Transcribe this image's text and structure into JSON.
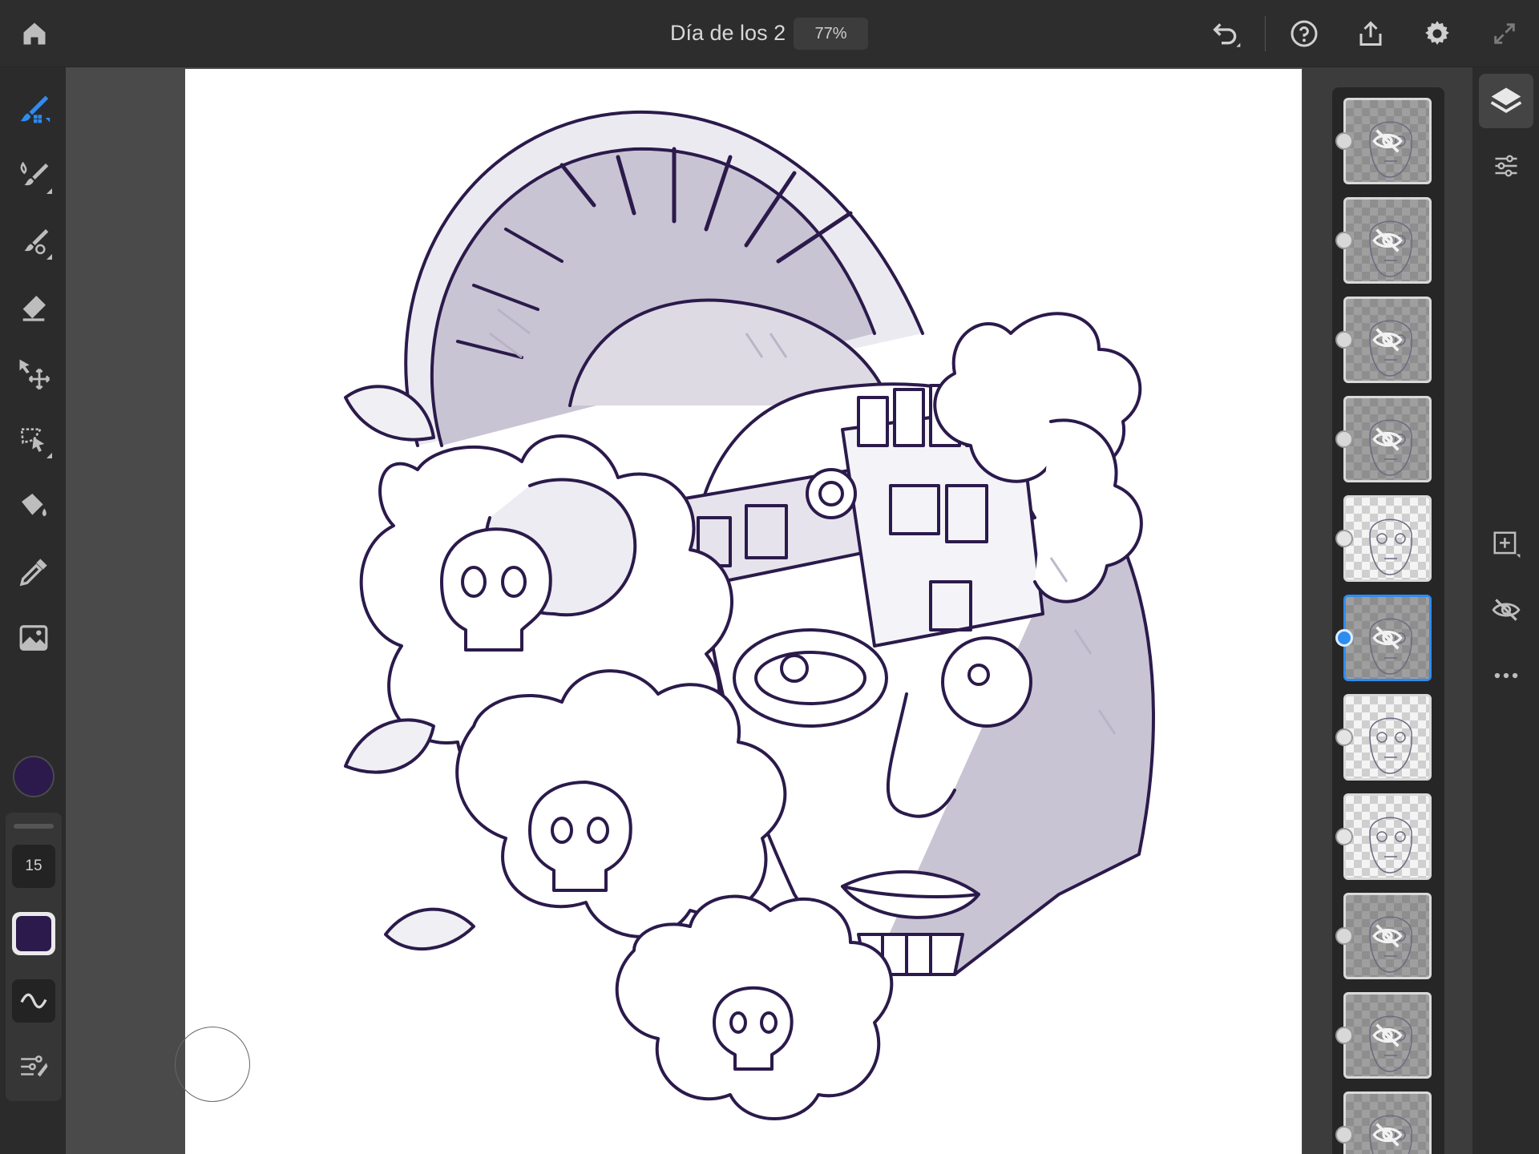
{
  "app": {
    "document_title": "Día de los 2",
    "zoom": "77%"
  },
  "left_toolbar": {
    "tools": [
      "pixel-brush",
      "live-brush",
      "mixer-brush",
      "eraser",
      "transform",
      "selection",
      "fill",
      "eyedropper",
      "place-image"
    ],
    "active_tool": "pixel-brush",
    "current_color": "#2b1a4b",
    "brush_size": "15"
  },
  "layers": {
    "items": [
      {
        "hidden": true,
        "selected": false
      },
      {
        "hidden": true,
        "selected": false
      },
      {
        "hidden": true,
        "selected": false
      },
      {
        "hidden": true,
        "selected": false
      },
      {
        "hidden": false,
        "selected": false
      },
      {
        "hidden": true,
        "selected": true
      },
      {
        "hidden": false,
        "selected": false
      },
      {
        "hidden": false,
        "selected": false
      },
      {
        "hidden": true,
        "selected": false
      },
      {
        "hidden": true,
        "selected": false
      },
      {
        "hidden": true,
        "selected": false
      }
    ]
  },
  "right_toolbar": {
    "buttons": [
      "layers",
      "layer-properties",
      "add-layer",
      "hide-layer",
      "more-options"
    ]
  },
  "colors": {
    "accent": "#2e8cf0",
    "ink": "#2b1a4b"
  }
}
